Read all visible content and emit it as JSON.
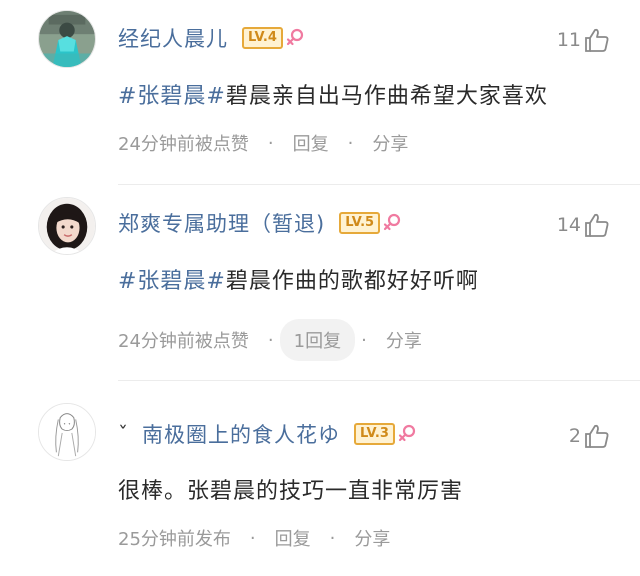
{
  "comments": [
    {
      "name_prefix": "",
      "name": "经纪人晨儿",
      "level": "LV.4",
      "likes": "11",
      "tag": "#张碧晨#",
      "text": "碧晨亲自出马作曲希望大家喜欢",
      "time": "24分钟前被点赞",
      "reply": "回复",
      "share": "分享",
      "avatar": "teal-figure",
      "gender_icon": "female-icon"
    },
    {
      "name_prefix": "",
      "name": "郑爽专属助理（暂退)",
      "level": "LV.5",
      "likes": "14",
      "tag": "#张碧晨#",
      "text": "碧晨作曲的歌都好好听啊",
      "time": "24分钟前被点赞",
      "reply": "1回复",
      "share": "分享",
      "avatar": "woman-photo",
      "gender_icon": "female-icon"
    },
    {
      "name_prefix": "ˇ",
      "name": "南极圈上的食人花ゆ",
      "level": "LV.3",
      "likes": "2",
      "tag": "",
      "text": "很棒。张碧晨的技巧一直非常厉害",
      "time": "25分钟前发布",
      "reply": "回复",
      "share": "分享",
      "avatar": "sketch-girl",
      "gender_icon": "female-icon"
    }
  ],
  "colors": {
    "name": "#4a6e9c",
    "tag": "#4a6e9c",
    "level_border": "#e6a93a",
    "level_bg": "#fff2d2",
    "female_icon": "#f07aa0",
    "meta": "#9a9a9a"
  }
}
